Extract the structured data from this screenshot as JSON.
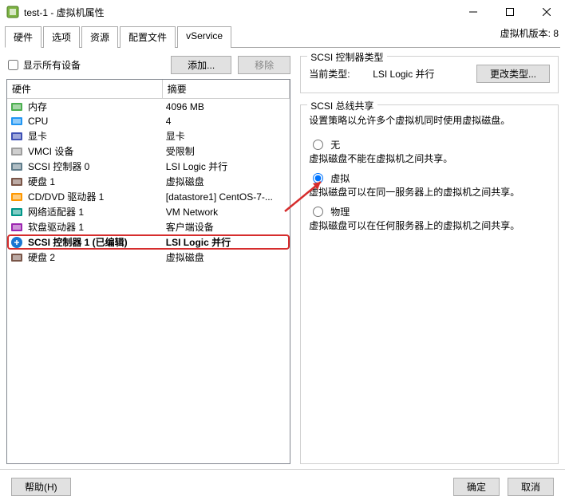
{
  "window": {
    "title": "test-1 - 虚拟机属性",
    "version_label": "虚拟机版本: 8"
  },
  "tabs": {
    "t0": "硬件",
    "t1": "选项",
    "t2": "资源",
    "t3": "配置文件",
    "t4": "vService"
  },
  "toolbar": {
    "show_all": "显示所有设备",
    "add": "添加...",
    "remove": "移除"
  },
  "table": {
    "h_hw": "硬件",
    "h_sum": "摘要",
    "rows": [
      {
        "n": "内存",
        "s": "4096 MB"
      },
      {
        "n": "CPU",
        "s": "4"
      },
      {
        "n": "显卡",
        "s": "显卡"
      },
      {
        "n": "VMCI 设备",
        "s": "受限制"
      },
      {
        "n": "SCSI 控制器 0",
        "s": "LSI Logic 并行"
      },
      {
        "n": "硬盘 1",
        "s": "虚拟磁盘"
      },
      {
        "n": "CD/DVD 驱动器 1",
        "s": "[datastore1] CentOS-7-..."
      },
      {
        "n": "网络适配器 1",
        "s": "VM Network"
      },
      {
        "n": "软盘驱动器 1",
        "s": "客户端设备"
      },
      {
        "n": "SCSI 控制器 1 (已编辑)",
        "s": "LSI Logic 并行"
      },
      {
        "n": "硬盘 2",
        "s": "虚拟磁盘"
      }
    ]
  },
  "ctrl_type": {
    "legend": "SCSI 控制器类型",
    "label": "当前类型:",
    "value": "LSI Logic 并行",
    "change": "更改类型..."
  },
  "bus": {
    "legend": "SCSI 总线共享",
    "hint": "设置策略以允许多个虚拟机同时使用虚拟磁盘。",
    "none": "无",
    "none_desc": "虚拟磁盘不能在虚拟机之间共享。",
    "virt": "虚拟",
    "virt_desc": "虚拟磁盘可以在同一服务器上的虚拟机之间共享。",
    "phys": "物理",
    "phys_desc": "虚拟磁盘可以在任何服务器上的虚拟机之间共享。"
  },
  "footer": {
    "help": "帮助(H)",
    "ok": "确定",
    "cancel": "取消"
  }
}
